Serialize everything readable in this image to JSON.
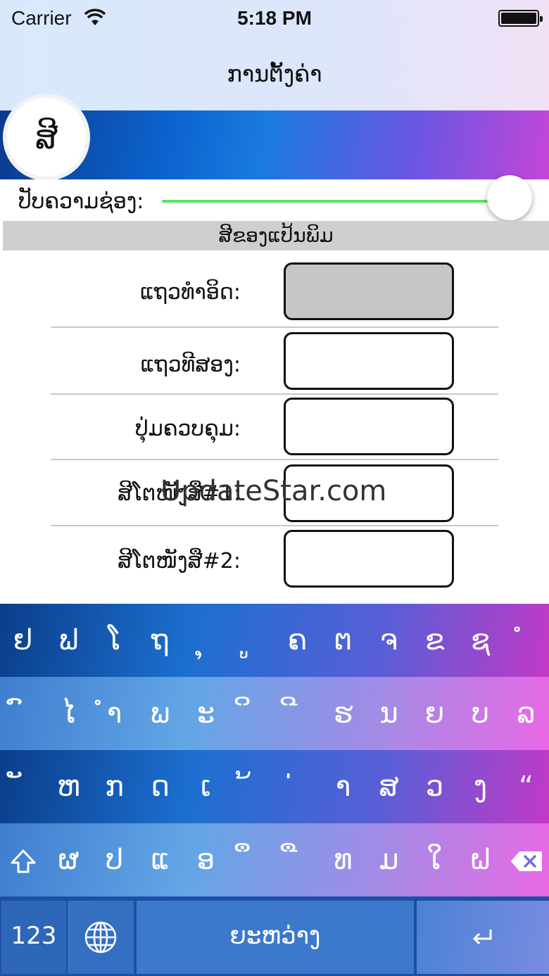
{
  "status_bar": {
    "carrier": "Carrier",
    "time": "5:18 PM",
    "wifi_icon": "wifi-icon",
    "battery_icon": "battery-icon"
  },
  "nav": {
    "title": "ການຕັ້ງຄ່າ"
  },
  "avatar": {
    "glyph": "ສີ"
  },
  "slider": {
    "label": "ປັບຄວາມຊ່ອງ:",
    "value_fraction": 1.0,
    "track_color": "#5be05b"
  },
  "section": {
    "title": "ສີຂອງແປ້ນພິມ"
  },
  "rows": [
    {
      "label": "ແຖວທຳອິດ:",
      "color": "#c6c6c6"
    },
    {
      "label": "ແຖວທີສອງ:",
      "color": "#ffffff"
    },
    {
      "label": "ປຸ່ມຄວບຄຸມ:",
      "color": "#ffffff"
    },
    {
      "label": "ສີໂຕໜັງສື#1:",
      "color": "#ffffff"
    },
    {
      "label": "ສີໂຕໜັງສື#2:",
      "color": "#ffffff"
    }
  ],
  "watermark": "UpdateStar.com",
  "keyboard": {
    "row1": [
      "ຢ",
      "ຟ",
      "ໂ",
      "ຖ",
      "ຸ",
      "ູ",
      "ຄ",
      "ຕ",
      "ຈ",
      "ຂ",
      "ຊ",
      "ໍ"
    ],
    "row2": [
      "ົ",
      "ໄ",
      "ຳ",
      "ພ",
      "ະ",
      "ິ",
      "ີ",
      "ຮ",
      "ນ",
      "ຍ",
      "ບ",
      "ລ"
    ],
    "row3": [
      "ັ",
      "ຫ",
      "ກ",
      "ດ",
      "ເ",
      "້",
      "່",
      "າ",
      "ສ",
      "ວ",
      "ງ",
      "“"
    ],
    "row4": [
      "ຜ",
      "ປ",
      "ແ",
      "ອ",
      "ຶ",
      "ື",
      "ທ",
      "ມ",
      "ໃ",
      "ຝ"
    ],
    "shift_icon": "shift-icon",
    "delete_icon": "delete-icon",
    "numbers_label": "123",
    "globe_icon": "globe-icon",
    "space_label": "ຍະຫວ່າງ",
    "return_icon": "return-icon"
  }
}
